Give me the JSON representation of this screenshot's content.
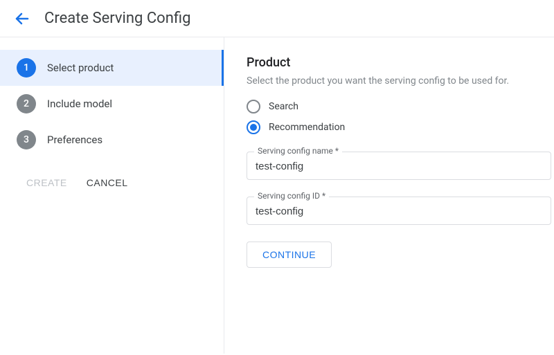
{
  "header": {
    "title": "Create Serving Config"
  },
  "sidebar": {
    "steps": [
      {
        "num": "1",
        "label": "Select product"
      },
      {
        "num": "2",
        "label": "Include model"
      },
      {
        "num": "3",
        "label": "Preferences"
      }
    ],
    "create_label": "Create",
    "cancel_label": "Cancel"
  },
  "main": {
    "section_title": "Product",
    "section_desc": "Select the product you want the serving config to be used for.",
    "radio_options": {
      "search": "Search",
      "recommendation": "Recommendation"
    },
    "name_field": {
      "label": "Serving config name *",
      "value": "test-config"
    },
    "id_field": {
      "label": "Serving config ID *",
      "value": "test-config"
    },
    "continue_label": "Continue"
  }
}
